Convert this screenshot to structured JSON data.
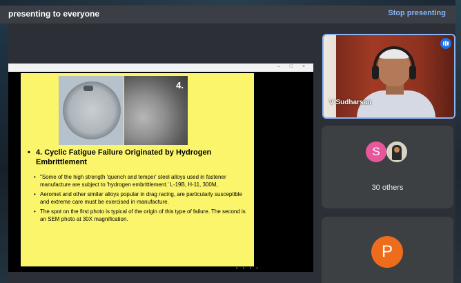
{
  "banner": {
    "text": "presenting to everyone",
    "stop_label": "Stop presenting"
  },
  "slide": {
    "photo_number": "4.",
    "heading": "4. Cyclic Fatigue Failure Originated by Hydrogen Embrittlement",
    "bullets": [
      "\"Some of the high strength 'quench and temper' steel alloys used in fastener manufacture are subject to 'hydrogen embrittlement.' L-19B, H-11, 300M,",
      "Aeromet and other similar alloys popular in drag racing, are particularly susceptible and extreme care must be exercised in manufacture.",
      "The spot on the first photo is typical of the origin of this type of failure. The second is an SEM photo at 30X magnification."
    ]
  },
  "presenter": {
    "name": "V Sudharsan"
  },
  "others": {
    "avatar_initial": "S",
    "label": "30 others"
  },
  "participant_p": {
    "avatar_initial": "P"
  },
  "colors": {
    "accent": "#8ab4f8",
    "slide_bg": "#fbf56b",
    "avatar_s": "#e8579b",
    "avatar_p": "#ee6c1c",
    "mic_badge": "#1a73e8"
  },
  "icons": [
    "mic-active-icon"
  ]
}
